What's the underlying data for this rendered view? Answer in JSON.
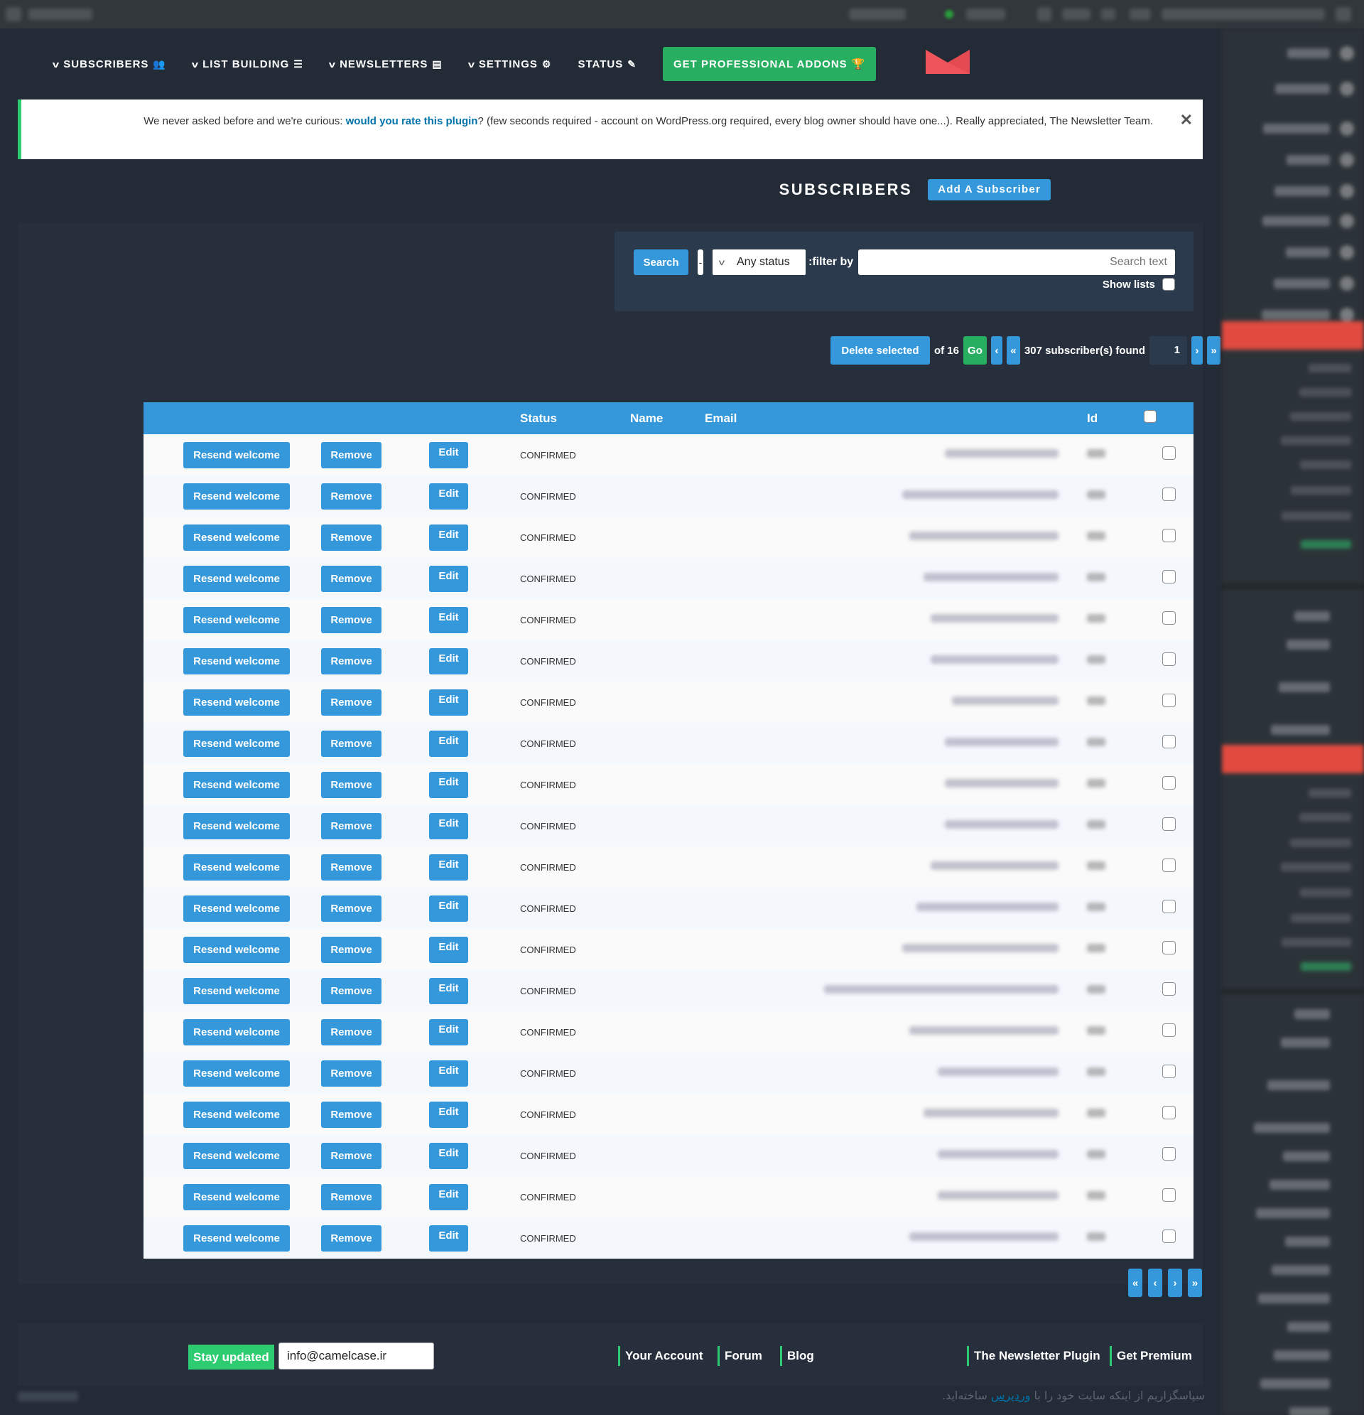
{
  "admin_bar": {
    "blurred": true
  },
  "nav": {
    "items": [
      {
        "label": "SUBSCRIBERS",
        "has_dropdown": true,
        "icon": "users-icon",
        "glyph": "👥"
      },
      {
        "label": "LIST BUILDING",
        "has_dropdown": true,
        "icon": "list-icon",
        "glyph": "☰"
      },
      {
        "label": "NEWSLETTERS",
        "has_dropdown": true,
        "icon": "newspaper-icon",
        "glyph": "▤"
      },
      {
        "label": "SETTINGS",
        "has_dropdown": true,
        "icon": "gear-icon",
        "glyph": "⚙"
      },
      {
        "label": "STATUS",
        "has_dropdown": false,
        "icon": "thermometer-icon",
        "glyph": "✎"
      }
    ],
    "pro_button": {
      "label": "GET PROFESSIONAL ADDONS",
      "icon": "trophy-icon",
      "glyph": "🏆"
    },
    "logo": "envelope-logo"
  },
  "notice": {
    "text_before": "We never asked before and we're curious: ",
    "link": "would you rate this plugin",
    "text_after": "? (few seconds required - account on WordPress.org required, every blog owner should have one...). Really appreciated, The Newsletter Team.",
    "close_glyph": "✕"
  },
  "header": {
    "title": "SUBSCRIBERS",
    "add_button": "Add A Subscriber"
  },
  "filter": {
    "search_button": "Search",
    "dash": "-",
    "status_select": "Any status",
    "filter_label": ":filter by",
    "search_placeholder": "Search text",
    "search_value": "",
    "show_lists_label": "Show lists",
    "show_lists_checked": false
  },
  "pagination": {
    "delete_selected": "Delete selected",
    "of_pages": "of 16",
    "go": "Go",
    "prev": "‹",
    "first": "«",
    "found": "307 subscriber(s) found",
    "current_page": "1",
    "next": "›",
    "last": "»"
  },
  "table": {
    "columns": [
      "",
      "",
      "",
      "Status",
      "Name",
      "Email",
      "Id",
      ""
    ],
    "row_actions": {
      "resend": "Resend welcome",
      "remove": "Remove",
      "edit": "Edit"
    },
    "rows": [
      {
        "status": "CONFIRMED",
        "name": "",
        "email": "[redacted]",
        "id": "—"
      },
      {
        "status": "CONFIRMED",
        "name": "",
        "email": "[redacted]",
        "id": "—"
      },
      {
        "status": "CONFIRMED",
        "name": "",
        "email": "[redacted]",
        "id": "—"
      },
      {
        "status": "CONFIRMED",
        "name": "",
        "email": "[redacted]",
        "id": "—"
      },
      {
        "status": "CONFIRMED",
        "name": "",
        "email": "[redacted]",
        "id": "—"
      },
      {
        "status": "CONFIRMED",
        "name": "",
        "email": "[redacted]",
        "id": "—"
      },
      {
        "status": "CONFIRMED",
        "name": "",
        "email": "[redacted]",
        "id": "—"
      },
      {
        "status": "CONFIRMED",
        "name": "",
        "email": "[redacted]",
        "id": "—"
      },
      {
        "status": "CONFIRMED",
        "name": "",
        "email": "[redacted]",
        "id": "—"
      },
      {
        "status": "CONFIRMED",
        "name": "",
        "email": "[redacted]",
        "id": "—"
      },
      {
        "status": "CONFIRMED",
        "name": "",
        "email": "[redacted]",
        "id": "—"
      },
      {
        "status": "CONFIRMED",
        "name": "",
        "email": "[redacted]",
        "id": "—"
      },
      {
        "status": "CONFIRMED",
        "name": "",
        "email": "[redacted]",
        "id": "—"
      },
      {
        "status": "CONFIRMED",
        "name": "",
        "email": "[redacted]",
        "id": "—"
      },
      {
        "status": "CONFIRMED",
        "name": "",
        "email": "[redacted]",
        "id": "—"
      },
      {
        "status": "CONFIRMED",
        "name": "",
        "email": "[redacted]",
        "id": "—"
      },
      {
        "status": "CONFIRMED",
        "name": "",
        "email": "[redacted]",
        "id": "—"
      },
      {
        "status": "CONFIRMED",
        "name": "",
        "email": "[redacted]",
        "id": "—"
      },
      {
        "status": "CONFIRMED",
        "name": "",
        "email": "[redacted]",
        "id": "—"
      },
      {
        "status": "CONFIRMED",
        "name": "",
        "email": "[redacted]",
        "id": "—"
      }
    ]
  },
  "bottom_pagination": {
    "first": "«",
    "prev": "‹",
    "next": "›",
    "last": "»"
  },
  "footer": {
    "stay_updated": "Stay updated",
    "email_value": "info@camelcase.ir",
    "links_left": [
      "Your Account",
      "Forum",
      "Blog"
    ],
    "links_right": [
      "The Newsletter Plugin",
      "Get Premium"
    ]
  },
  "wp_footer": {
    "text_before": "سپاسگزاریم از اینکه سایت خود را با ",
    "link": "وردپرس",
    "text_after": " ساخته‌اید."
  },
  "colors": {
    "accent_blue": "#3498db",
    "accent_green": "#27ae60",
    "brand_red": "#e04a3f",
    "page_bg": "#232b36"
  }
}
